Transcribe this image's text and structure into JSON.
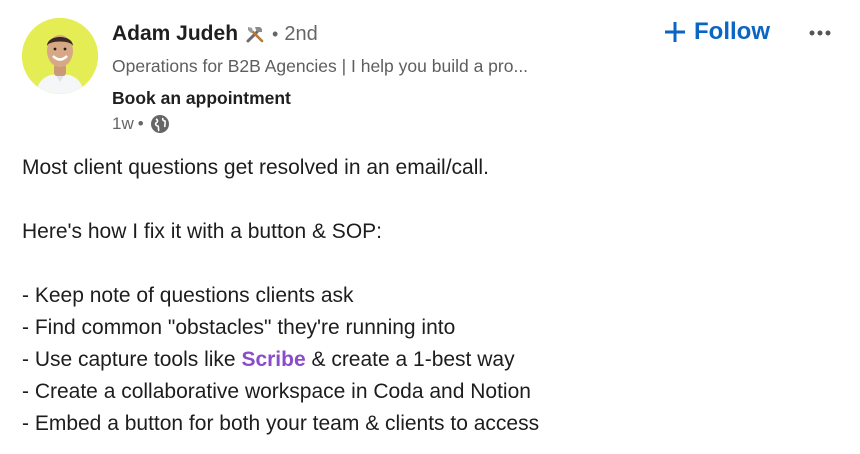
{
  "author": {
    "name": "Adam Judeh",
    "name_icon": "tools-icon",
    "separator": "•",
    "degree": "2nd",
    "headline": "Operations for B2B Agencies | I help you build a pro...",
    "cta_label": "Book an appointment",
    "age": "1w",
    "meta_separator": "•",
    "visibility_icon": "globe-icon",
    "avatar_bg": "#e4ee54"
  },
  "actions": {
    "follow_label": "Follow",
    "follow_icon": "plus-icon",
    "more_icon": "more-horizontal-icon",
    "accent": "#0a66c2"
  },
  "post": {
    "line1": "Most client questions get resolved in an email/call.",
    "line2": "Here's how I fix it with a button & SOP:",
    "bullet1": "- Keep note of questions clients ask",
    "bullet2": "- Find common \"obstacles\" they're running into",
    "bullet3_prefix": "- Use capture tools like ",
    "bullet3_mention": "Scribe",
    "bullet3_suffix": " & create a 1-best way",
    "bullet4": "- Create a collaborative workspace in Coda and Notion",
    "bullet5": "- Embed a button for both your team & clients to access",
    "mention_color": "#8a4cc9"
  }
}
